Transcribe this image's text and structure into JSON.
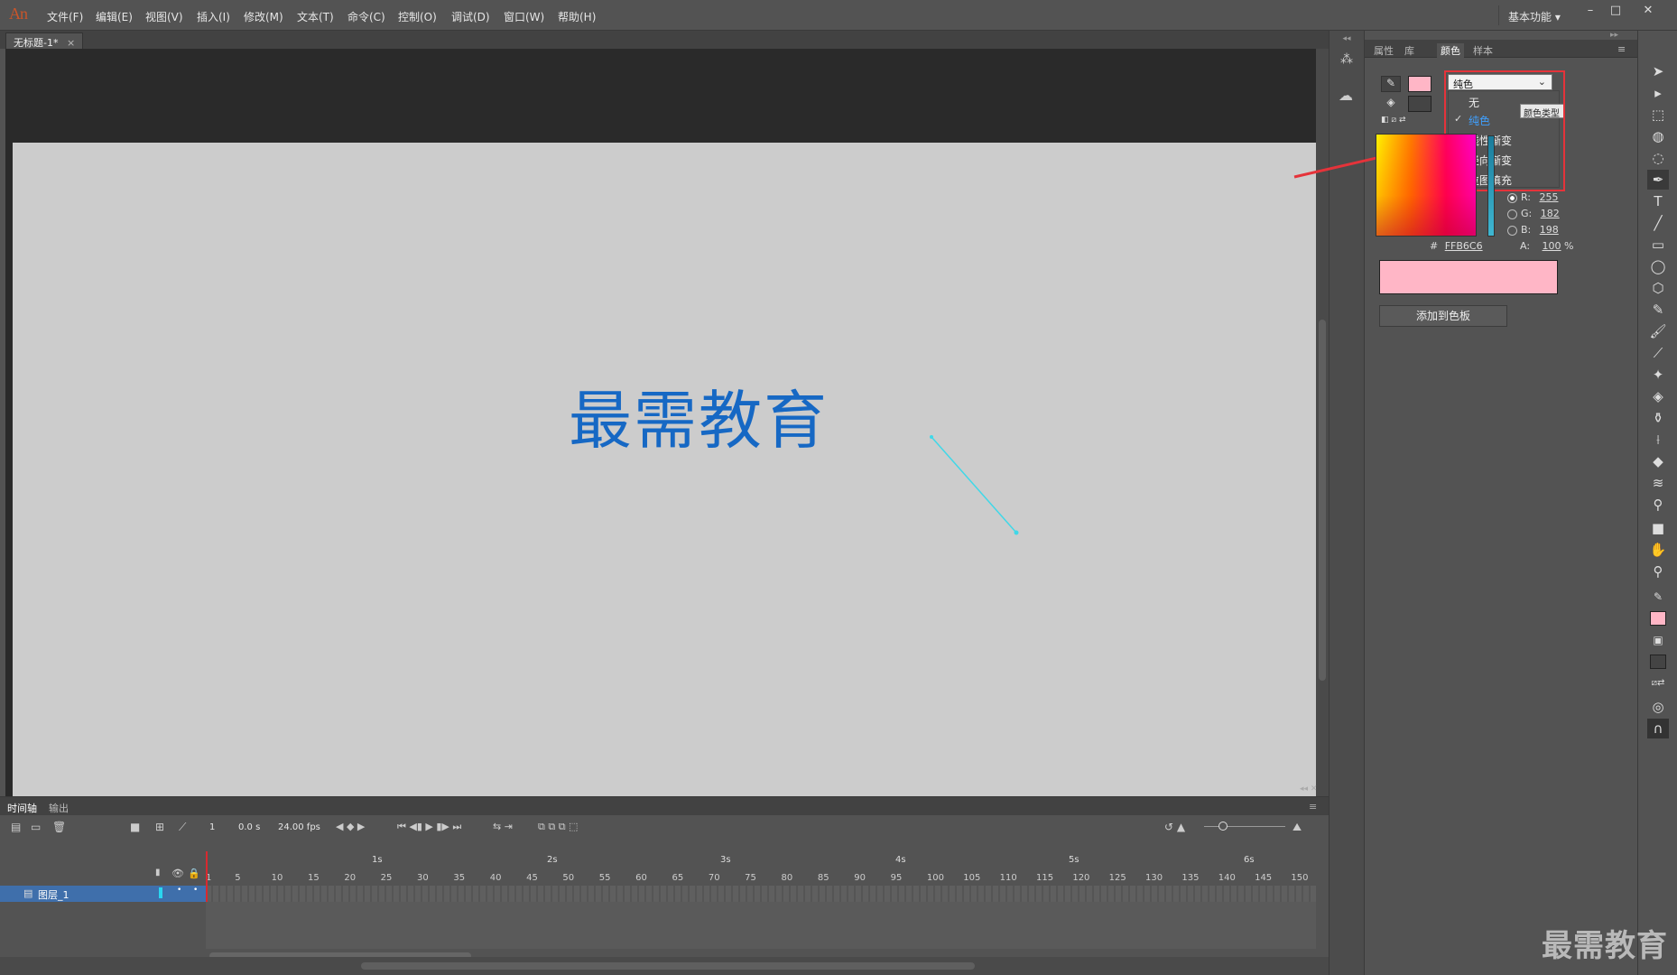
{
  "app": {
    "logo": "An",
    "workspace": "基本功能"
  },
  "menu": [
    "文件(F)",
    "编辑(E)",
    "视图(V)",
    "插入(I)",
    "修改(M)",
    "文本(T)",
    "命令(C)",
    "控制(O)",
    "调试(D)",
    "窗口(W)",
    "帮助(H)"
  ],
  "document": {
    "tab_title": "无标题-1*",
    "close": "×"
  },
  "stage": {
    "text": "最需教育",
    "text_color": "#1668c4",
    "line_color": "#40d8e8"
  },
  "panel": {
    "tabs": [
      "属性",
      "库",
      "颜色",
      "样本"
    ],
    "active_tab": "颜色",
    "fill_type": "纯色",
    "fill_type_options": [
      "无",
      "纯色",
      "线性渐变",
      "径向渐变",
      "位图填充"
    ],
    "selected_option": "纯色",
    "tooltip": "颜色类型",
    "rgb": {
      "r_label": "R:",
      "r": "255",
      "g_label": "G:",
      "g": "182",
      "b_label": "B:",
      "b": "198",
      "a_label": "A:",
      "a": "100",
      "a_unit": "%"
    },
    "hex_prefix": "#",
    "hex": "FFB6C6",
    "current_color": "#ffb6c6",
    "add_swatch": "添加到色板"
  },
  "timeline": {
    "tabs": [
      "时间轴",
      "输出"
    ],
    "current_frame": "1",
    "time": "0.0 s",
    "fps": "24.00 fps",
    "layer_name": "图层_1",
    "seconds": [
      "1s",
      "2s",
      "3s",
      "4s",
      "5s",
      "6s"
    ],
    "frame_numbers": [
      "1",
      "5",
      "10",
      "15",
      "20",
      "25",
      "30",
      "35",
      "40",
      "45",
      "50",
      "55",
      "60",
      "65",
      "70",
      "75",
      "80",
      "85",
      "90",
      "95",
      "100",
      "105",
      "110",
      "115",
      "120",
      "125",
      "130",
      "135",
      "140",
      "145",
      "150"
    ]
  },
  "watermark": "最需教育"
}
